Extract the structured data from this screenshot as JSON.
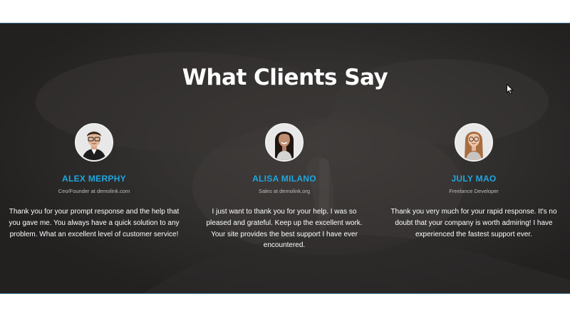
{
  "section": {
    "title": "What Clients Say"
  },
  "testimonials": [
    {
      "name": "ALEX MERPHY",
      "role": "Ceo/Founder at demolink.com",
      "quote": "Thank you for your prompt response and the help that you gave me. You always have a quick solution to any problem. What an excellent level of customer service!",
      "avatar_icon": "man-with-glasses-avatar"
    },
    {
      "name": "ALISA MILANO",
      "role": "Sales at demolink.org",
      "quote": "I just want to thank you for your help. I was so pleased and grateful. Keep up the excellent work. Your site provides the best support I have ever encountered.",
      "avatar_icon": "woman-dark-hair-avatar"
    },
    {
      "name": "JULY MAO",
      "role": "Freelance Developer",
      "quote": "Thank you very much for your rapid response. It's no doubt that your company is worth admiring! I have experienced the fastest support ever.",
      "avatar_icon": "woman-with-glasses-avatar"
    }
  ],
  "colors": {
    "name_accent": "#1fa6e0",
    "section_bg": "#2e2c2b",
    "text": "#ffffff"
  }
}
